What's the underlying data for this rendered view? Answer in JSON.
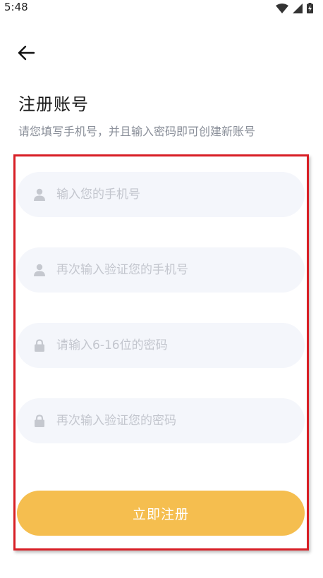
{
  "status_bar": {
    "time": "5:48",
    "icons": [
      "wifi-icon",
      "cellular-signal-icon",
      "battery-charging-icon"
    ]
  },
  "header": {
    "back_icon": "arrow-left-icon",
    "title": "注册账号",
    "subtitle": "请您填写手机号，并且输入密码即可创建新账号"
  },
  "form": {
    "phone": {
      "icon": "user-icon",
      "placeholder": "输入您的手机号",
      "value": ""
    },
    "phone_confirm": {
      "icon": "user-icon",
      "placeholder": "再次输入验证您的手机号",
      "value": ""
    },
    "password": {
      "icon": "lock-icon",
      "placeholder": "请输入6-16位的密码",
      "value": ""
    },
    "password_confirm": {
      "icon": "lock-icon",
      "placeholder": "再次输入验证您的密码",
      "value": ""
    },
    "submit_label": "立即注册"
  },
  "colors": {
    "accent": "#f5be4f",
    "field_background": "#f4f6fb",
    "placeholder": "#c3c6ce",
    "highlight_border": "#d81e25"
  }
}
